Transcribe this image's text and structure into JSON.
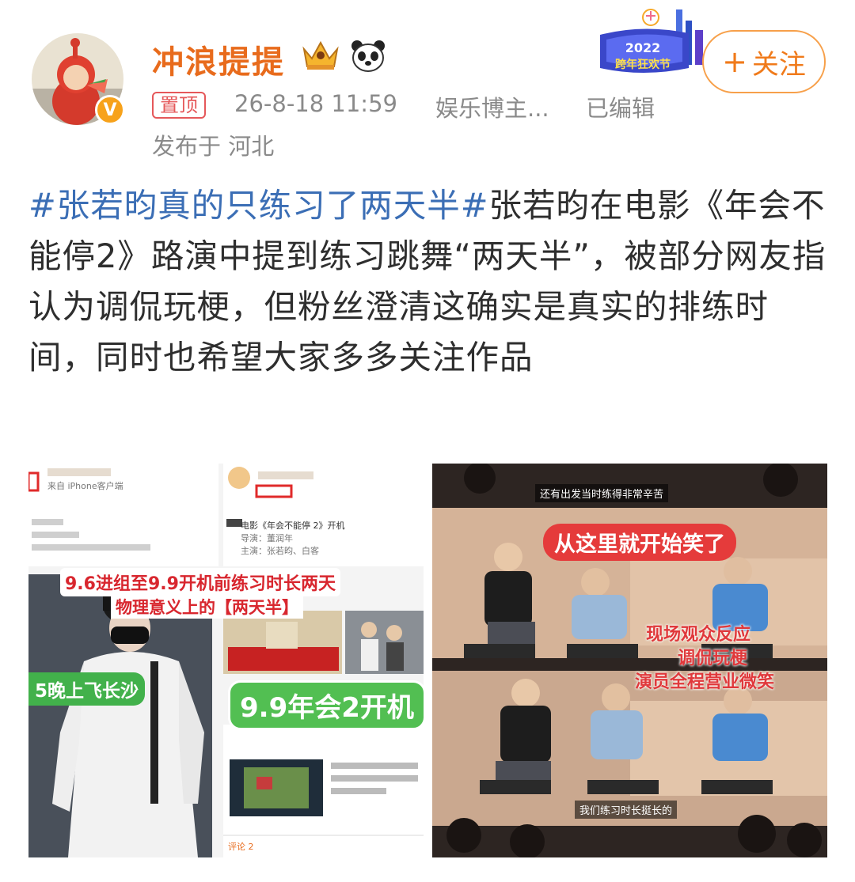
{
  "post": {
    "author": {
      "name": "冲浪提提",
      "avatar_badge": "V",
      "badges": [
        "crown-icon",
        "panda-icon"
      ]
    },
    "pinned_label": "置顶",
    "timestamp": "26-8-18 11:59",
    "source": "娱乐博主...",
    "edited_label": "已编辑",
    "location": "发布于 河北",
    "follow_button": {
      "plus": "+",
      "label": "关注"
    },
    "event_banner": {
      "year": "2022",
      "title": "跨年狂欢节"
    },
    "hashtag": "#张若昀真的只练习了两天半#",
    "body": "张若昀在电影《年会不能停2》路演中提到练习跳舞“两天半”，被部分网友指认为调侃玩梗，但粉丝澄清这确实是真实的排练时间，同时也希望大家多多关注作品"
  },
  "images": {
    "left": {
      "caption_timeline": "9.6进组至9.9开机前练习时长两天",
      "caption_physics": "物理意义上的【两天半】",
      "caption_flight": "5晚上飞长沙",
      "caption_start": "9.9年会2开机",
      "small_movie": "电影《年会不能停 2》开机",
      "small_director": "导演：董润年",
      "small_cast": "主演：张若昀、白客",
      "small_phone": "来自 iPhone客户端",
      "small_comment": "评论 2"
    },
    "right": {
      "caption_laugh": "从这里就开始笑了",
      "caption_red_1": "调侃玩梗",
      "caption_red_2": "演员全程营业微笑",
      "caption_red_3": "现场观众反应",
      "subtitle_top": "还有出发当时练得非常辛苦",
      "subtitle_bottom": "我们练习时长挺长的"
    }
  },
  "colors": {
    "username": "#e86b1c",
    "hashtag": "#3b6eb5",
    "follow": "#f07a1a",
    "pin": "#e5585a",
    "meta": "#8a8a8a"
  }
}
